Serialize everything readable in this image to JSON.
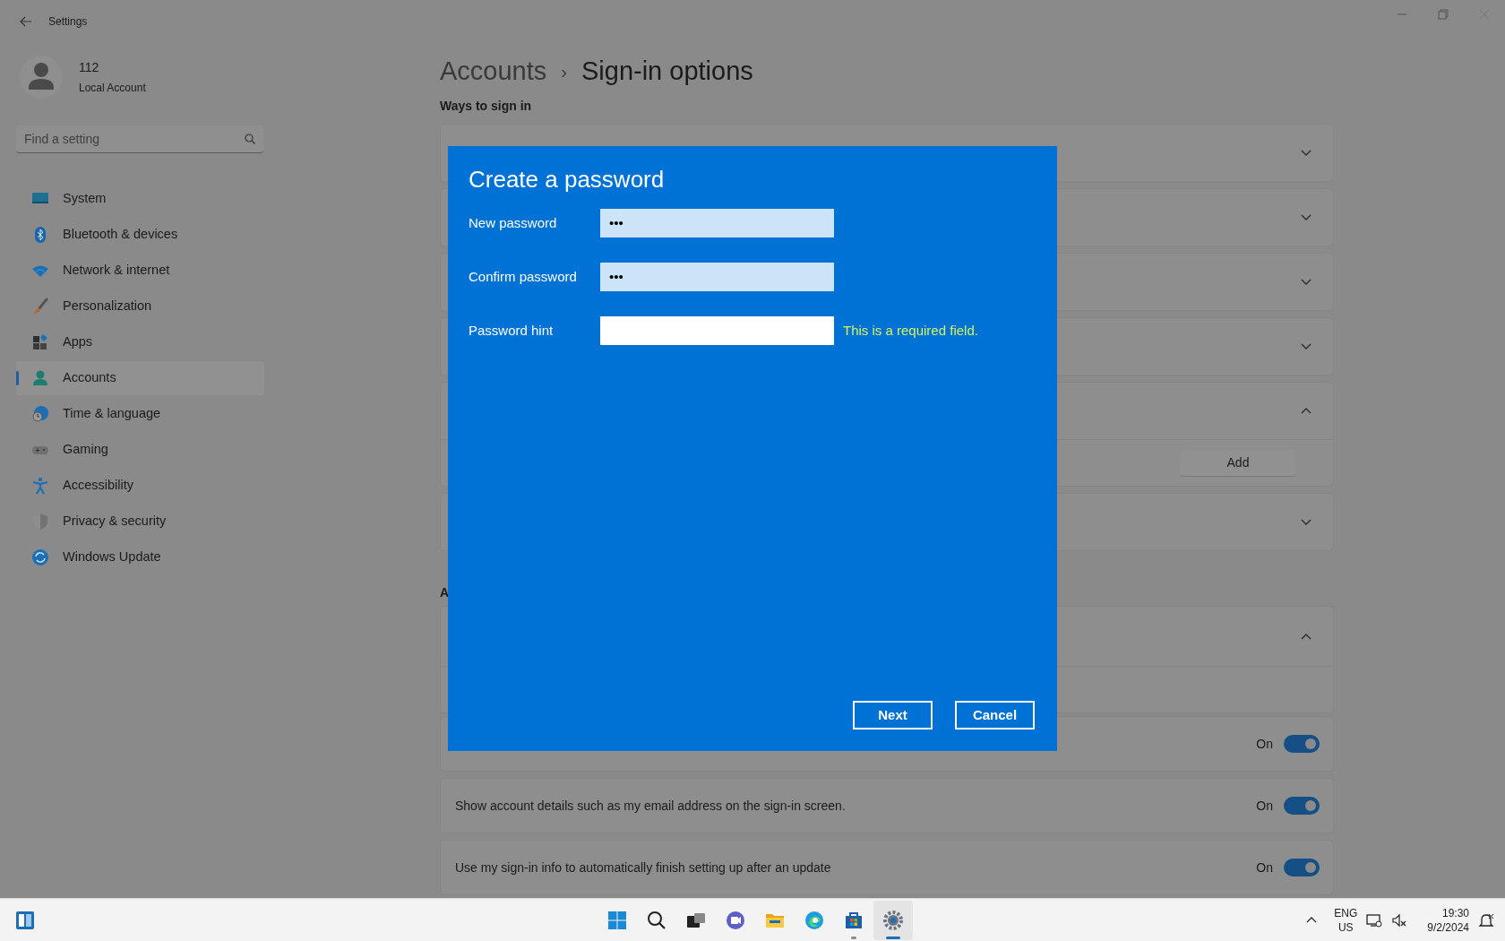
{
  "window": {
    "title": "Settings"
  },
  "account": {
    "name": "112",
    "type": "Local Account"
  },
  "search": {
    "placeholder": "Find a setting"
  },
  "nav": [
    {
      "label": "System",
      "selected": false
    },
    {
      "label": "Bluetooth & devices",
      "selected": false
    },
    {
      "label": "Network & internet",
      "selected": false
    },
    {
      "label": "Personalization",
      "selected": false
    },
    {
      "label": "Apps",
      "selected": false
    },
    {
      "label": "Accounts",
      "selected": true
    },
    {
      "label": "Time & language",
      "selected": false
    },
    {
      "label": "Gaming",
      "selected": false
    },
    {
      "label": "Accessibility",
      "selected": false
    },
    {
      "label": "Privacy & security",
      "selected": false
    },
    {
      "label": "Windows Update",
      "selected": false
    }
  ],
  "breadcrumb": {
    "parent": "Accounts",
    "separator": "›",
    "current": "Sign-in options"
  },
  "ways_to_sign_in": {
    "heading": "Ways to sign in",
    "cards": [
      {
        "expanded": false
      },
      {
        "expanded": false
      },
      {
        "expanded": false
      },
      {
        "expanded": false
      },
      {
        "expanded": true,
        "action": "Add"
      },
      {
        "expanded": false
      }
    ]
  },
  "additional": {
    "heading": "A",
    "card": {
      "expanded": true
    },
    "settings": [
      {
        "state": "On",
        "on": true
      },
      {
        "label": "Show account details such as my email address on the sign-in screen.",
        "state": "On",
        "on": true
      },
      {
        "label": "Use my sign-in info to automatically finish setting up after an update",
        "state": "On",
        "on": true
      }
    ]
  },
  "dialog": {
    "title": "Create a password",
    "fields": [
      {
        "label": "New password",
        "value": "•••",
        "focused": false
      },
      {
        "label": "Confirm password",
        "value": "•••",
        "focused": false
      },
      {
        "label": "Password hint",
        "focused": true,
        "error": "This is a required field."
      }
    ],
    "buttons": [
      "Next",
      "Cancel"
    ]
  },
  "taskbar": {
    "apps": [
      {
        "running": false,
        "active": false
      },
      {
        "running": false,
        "active": false
      },
      {
        "running": false,
        "active": false
      },
      {
        "running": false,
        "active": false
      },
      {
        "running": false,
        "active": false
      },
      {
        "running": false,
        "active": false
      },
      {
        "running": true,
        "active": false
      },
      {
        "running": true,
        "active": true
      }
    ],
    "language": "ENG",
    "region": "US",
    "time": "19:30",
    "date": "9/2/2024"
  }
}
